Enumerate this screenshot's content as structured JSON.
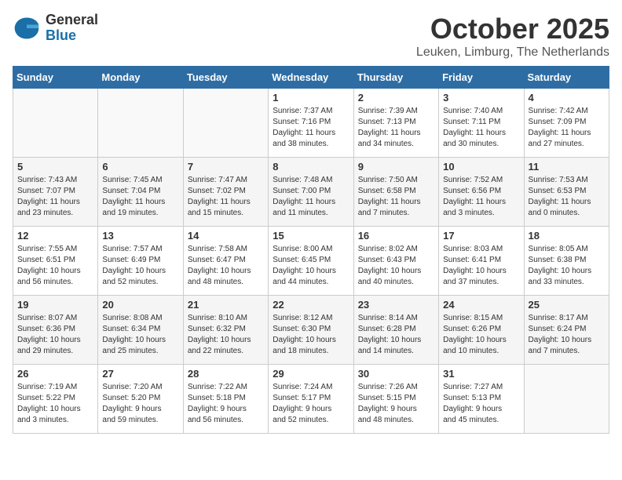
{
  "header": {
    "logo_general": "General",
    "logo_blue": "Blue",
    "month_title": "October 2025",
    "location": "Leuken, Limburg, The Netherlands"
  },
  "weekdays": [
    "Sunday",
    "Monday",
    "Tuesday",
    "Wednesday",
    "Thursday",
    "Friday",
    "Saturday"
  ],
  "weeks": [
    [
      {
        "day": "",
        "info": ""
      },
      {
        "day": "",
        "info": ""
      },
      {
        "day": "",
        "info": ""
      },
      {
        "day": "1",
        "info": "Sunrise: 7:37 AM\nSunset: 7:16 PM\nDaylight: 11 hours\nand 38 minutes."
      },
      {
        "day": "2",
        "info": "Sunrise: 7:39 AM\nSunset: 7:13 PM\nDaylight: 11 hours\nand 34 minutes."
      },
      {
        "day": "3",
        "info": "Sunrise: 7:40 AM\nSunset: 7:11 PM\nDaylight: 11 hours\nand 30 minutes."
      },
      {
        "day": "4",
        "info": "Sunrise: 7:42 AM\nSunset: 7:09 PM\nDaylight: 11 hours\nand 27 minutes."
      }
    ],
    [
      {
        "day": "5",
        "info": "Sunrise: 7:43 AM\nSunset: 7:07 PM\nDaylight: 11 hours\nand 23 minutes."
      },
      {
        "day": "6",
        "info": "Sunrise: 7:45 AM\nSunset: 7:04 PM\nDaylight: 11 hours\nand 19 minutes."
      },
      {
        "day": "7",
        "info": "Sunrise: 7:47 AM\nSunset: 7:02 PM\nDaylight: 11 hours\nand 15 minutes."
      },
      {
        "day": "8",
        "info": "Sunrise: 7:48 AM\nSunset: 7:00 PM\nDaylight: 11 hours\nand 11 minutes."
      },
      {
        "day": "9",
        "info": "Sunrise: 7:50 AM\nSunset: 6:58 PM\nDaylight: 11 hours\nand 7 minutes."
      },
      {
        "day": "10",
        "info": "Sunrise: 7:52 AM\nSunset: 6:56 PM\nDaylight: 11 hours\nand 3 minutes."
      },
      {
        "day": "11",
        "info": "Sunrise: 7:53 AM\nSunset: 6:53 PM\nDaylight: 11 hours\nand 0 minutes."
      }
    ],
    [
      {
        "day": "12",
        "info": "Sunrise: 7:55 AM\nSunset: 6:51 PM\nDaylight: 10 hours\nand 56 minutes."
      },
      {
        "day": "13",
        "info": "Sunrise: 7:57 AM\nSunset: 6:49 PM\nDaylight: 10 hours\nand 52 minutes."
      },
      {
        "day": "14",
        "info": "Sunrise: 7:58 AM\nSunset: 6:47 PM\nDaylight: 10 hours\nand 48 minutes."
      },
      {
        "day": "15",
        "info": "Sunrise: 8:00 AM\nSunset: 6:45 PM\nDaylight: 10 hours\nand 44 minutes."
      },
      {
        "day": "16",
        "info": "Sunrise: 8:02 AM\nSunset: 6:43 PM\nDaylight: 10 hours\nand 40 minutes."
      },
      {
        "day": "17",
        "info": "Sunrise: 8:03 AM\nSunset: 6:41 PM\nDaylight: 10 hours\nand 37 minutes."
      },
      {
        "day": "18",
        "info": "Sunrise: 8:05 AM\nSunset: 6:38 PM\nDaylight: 10 hours\nand 33 minutes."
      }
    ],
    [
      {
        "day": "19",
        "info": "Sunrise: 8:07 AM\nSunset: 6:36 PM\nDaylight: 10 hours\nand 29 minutes."
      },
      {
        "day": "20",
        "info": "Sunrise: 8:08 AM\nSunset: 6:34 PM\nDaylight: 10 hours\nand 25 minutes."
      },
      {
        "day": "21",
        "info": "Sunrise: 8:10 AM\nSunset: 6:32 PM\nDaylight: 10 hours\nand 22 minutes."
      },
      {
        "day": "22",
        "info": "Sunrise: 8:12 AM\nSunset: 6:30 PM\nDaylight: 10 hours\nand 18 minutes."
      },
      {
        "day": "23",
        "info": "Sunrise: 8:14 AM\nSunset: 6:28 PM\nDaylight: 10 hours\nand 14 minutes."
      },
      {
        "day": "24",
        "info": "Sunrise: 8:15 AM\nSunset: 6:26 PM\nDaylight: 10 hours\nand 10 minutes."
      },
      {
        "day": "25",
        "info": "Sunrise: 8:17 AM\nSunset: 6:24 PM\nDaylight: 10 hours\nand 7 minutes."
      }
    ],
    [
      {
        "day": "26",
        "info": "Sunrise: 7:19 AM\nSunset: 5:22 PM\nDaylight: 10 hours\nand 3 minutes."
      },
      {
        "day": "27",
        "info": "Sunrise: 7:20 AM\nSunset: 5:20 PM\nDaylight: 9 hours\nand 59 minutes."
      },
      {
        "day": "28",
        "info": "Sunrise: 7:22 AM\nSunset: 5:18 PM\nDaylight: 9 hours\nand 56 minutes."
      },
      {
        "day": "29",
        "info": "Sunrise: 7:24 AM\nSunset: 5:17 PM\nDaylight: 9 hours\nand 52 minutes."
      },
      {
        "day": "30",
        "info": "Sunrise: 7:26 AM\nSunset: 5:15 PM\nDaylight: 9 hours\nand 48 minutes."
      },
      {
        "day": "31",
        "info": "Sunrise: 7:27 AM\nSunset: 5:13 PM\nDaylight: 9 hours\nand 45 minutes."
      },
      {
        "day": "",
        "info": ""
      }
    ]
  ]
}
